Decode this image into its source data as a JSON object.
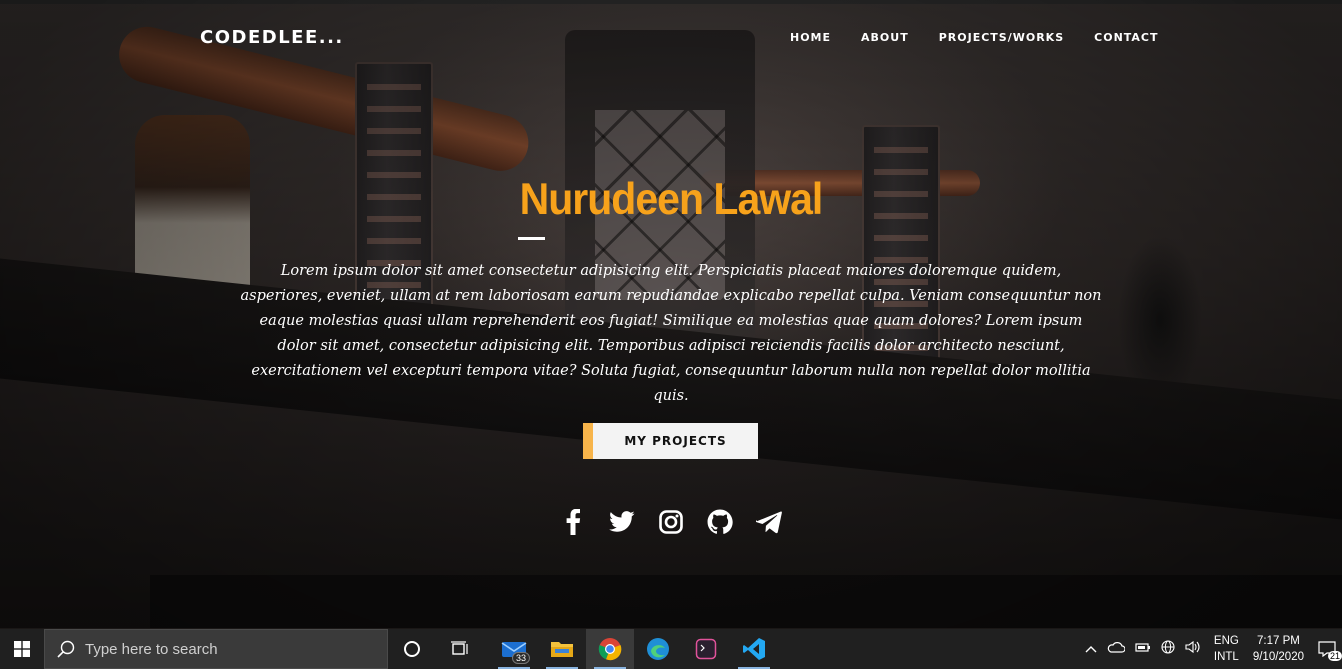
{
  "nav": {
    "brand": "CODEDLEE...",
    "links": [
      "HOME",
      "ABOUT",
      "PROJECTS/WORKS",
      "CONTACT"
    ]
  },
  "hero": {
    "name": "Nurudeen Lawal",
    "description": "Lorem ipsum dolor sit amet consectetur adipisicing elit. Perspiciatis placeat maiores doloremque quidem, asperiores, eveniet, ullam at rem laboriosam earum repudiandae explicabo repellat culpa. Veniam consequuntur non eaque molestias quasi ullam reprehenderit eos fugiat! Similique ea molestias quae quam dolores? Lorem ipsum dolor sit amet, consectetur adipisicing elit. Temporibus adipisci reiciendis facilis dolor architecto nesciunt, exercitationem vel excepturi tempora vitae? Soluta fugiat, consequuntur laborum nulla non repellat dolor mollitia quis.",
    "cta_label": "MY PROJECTS",
    "social_icons": [
      "facebook-icon",
      "twitter-icon",
      "instagram-icon",
      "github-icon",
      "telegram-icon"
    ]
  },
  "colors": {
    "accent": "#f7a21b",
    "cta_border": "#f7b44a",
    "taskbar": "#202020"
  },
  "taskbar": {
    "search_placeholder": "Type here to search",
    "mail_badge": "33",
    "language": [
      "ENG",
      "INTL"
    ],
    "time": "7:17 PM",
    "date": "9/10/2020",
    "notification_count": "21"
  }
}
